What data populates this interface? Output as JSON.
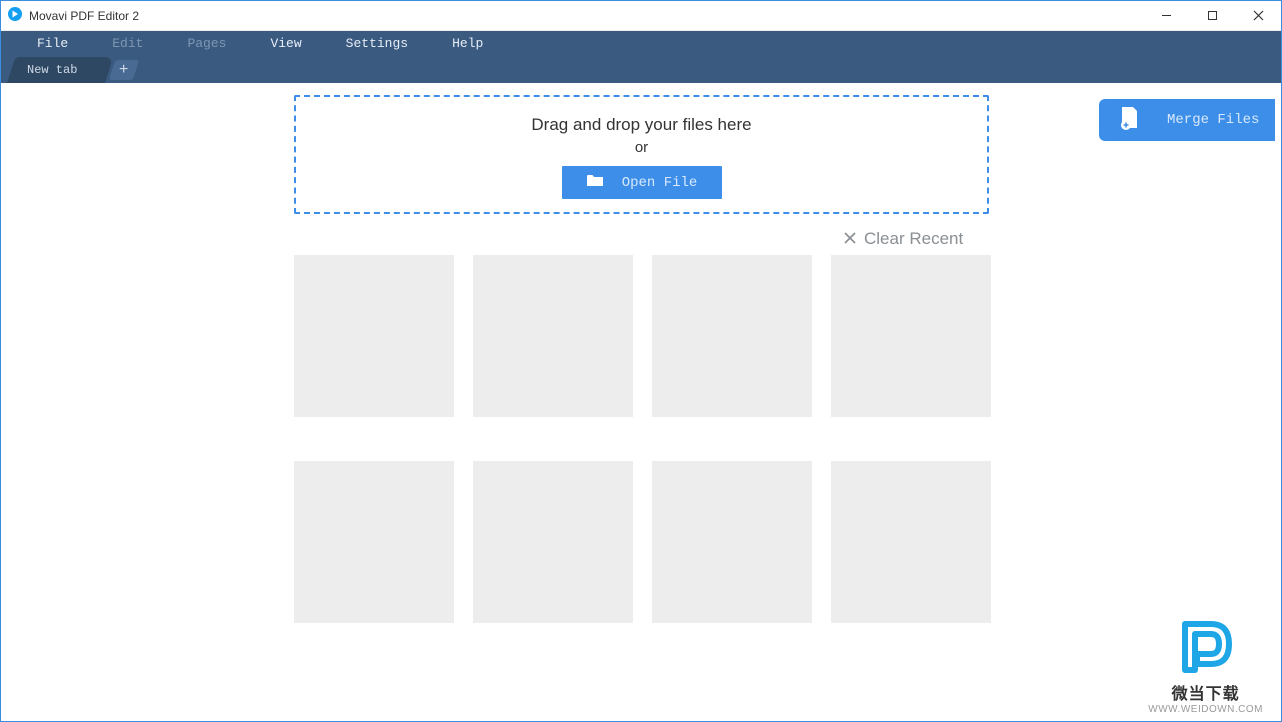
{
  "window": {
    "title": "Movavi PDF Editor 2"
  },
  "menu": {
    "items": [
      {
        "label": "File",
        "dim": false
      },
      {
        "label": "Edit",
        "dim": true
      },
      {
        "label": "Pages",
        "dim": true
      },
      {
        "label": "View",
        "dim": false
      },
      {
        "label": "Settings",
        "dim": false
      },
      {
        "label": "Help",
        "dim": false
      }
    ]
  },
  "tabs": {
    "active_label": "New tab"
  },
  "dropzone": {
    "line1": "Drag and drop your files here",
    "line2": "or",
    "open_label": "Open File"
  },
  "merge": {
    "label": "Merge Files"
  },
  "recent": {
    "clear_label": "Clear Recent",
    "thumbnails_count": 8
  },
  "watermark": {
    "cn": "微当下载",
    "url": "WWW.WEIDOWN.COM"
  }
}
